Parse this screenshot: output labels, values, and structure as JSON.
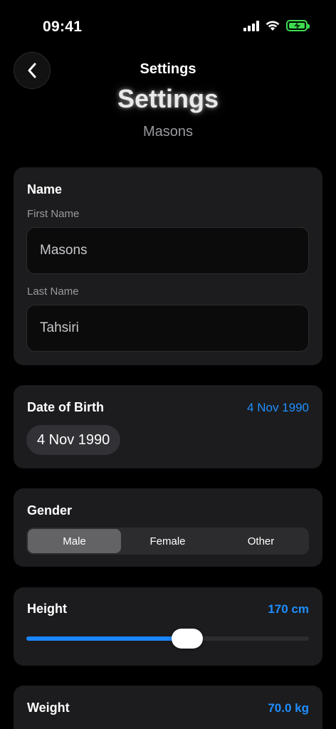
{
  "status_bar": {
    "time": "09:41"
  },
  "header": {
    "nav_title": "Settings",
    "large_title": "Settings",
    "subtitle": "Masons"
  },
  "name_card": {
    "title": "Name",
    "first_name_label": "First Name",
    "first_name_value": "Masons",
    "last_name_label": "Last Name",
    "last_name_value": "Tahsiri"
  },
  "dob_card": {
    "title": "Date of Birth",
    "value": "4 Nov 1990",
    "picker_value": "4 Nov 1990"
  },
  "gender_card": {
    "title": "Gender",
    "options": [
      "Male",
      "Female",
      "Other"
    ],
    "selected": "Male"
  },
  "height_card": {
    "title": "Height",
    "value": "170 cm",
    "slider_fraction": 0.57
  },
  "weight_card": {
    "title": "Weight",
    "value": "70.0 kg"
  },
  "colors": {
    "accent": "#1f8fff",
    "card_bg": "#1c1c1e",
    "battery": "#3ddc4f"
  },
  "icons": {
    "back": "chevron-left-icon",
    "signal": "cellular-signal-icon",
    "wifi": "wifi-icon",
    "battery": "battery-charging-icon"
  }
}
